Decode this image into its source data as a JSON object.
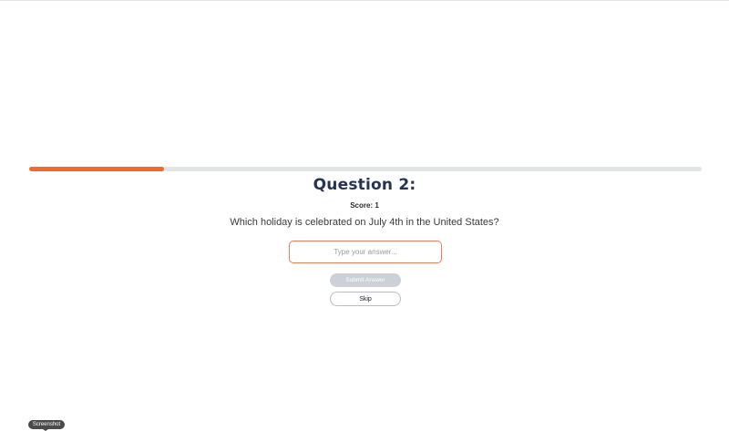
{
  "quiz": {
    "progress_percent": 20,
    "question_title": "Question 2:",
    "score_text": "Score: 1",
    "question_text": "Which holiday is celebrated on July 4th in the United States?",
    "answer_value": "",
    "answer_placeholder": "Type your answer...",
    "submit_label": "Submit Answer",
    "skip_label": "Skip"
  },
  "tooltip": {
    "text": "Screenshot"
  },
  "colors": {
    "accent": "#f26a24",
    "title": "#243452",
    "input_border": "#ee7a5f",
    "submit_disabled": "#ccd0d9",
    "track": "#e3e4e6"
  }
}
